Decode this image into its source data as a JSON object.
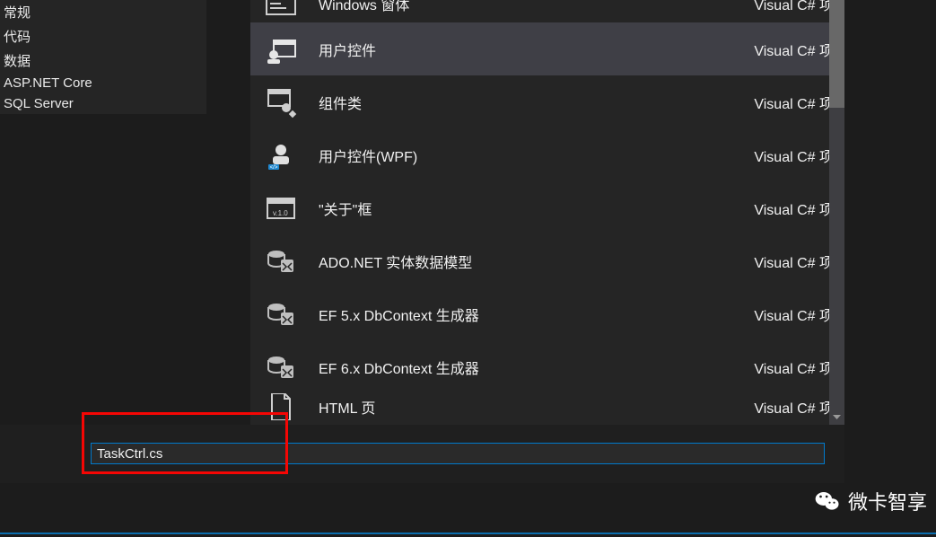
{
  "sidebar": {
    "items": [
      {
        "label": "常规"
      },
      {
        "label": "代码"
      },
      {
        "label": "数据"
      },
      {
        "label": "ASP.NET Core"
      },
      {
        "label": "SQL Server"
      }
    ]
  },
  "templates": {
    "lang": "Visual C# 项",
    "items": [
      {
        "label": "Windows 窗体",
        "icon": "winform",
        "selected": false
      },
      {
        "label": "用户控件",
        "icon": "usercontrol",
        "selected": true
      },
      {
        "label": "组件类",
        "icon": "component",
        "selected": false
      },
      {
        "label": "用户控件(WPF)",
        "icon": "ucwpf",
        "selected": false
      },
      {
        "label": "\"关于\"框",
        "icon": "about",
        "selected": false
      },
      {
        "label": "ADO.NET 实体数据模型",
        "icon": "ef",
        "selected": false
      },
      {
        "label": "EF 5.x DbContext 生成器",
        "icon": "ef",
        "selected": false
      },
      {
        "label": "EF 6.x DbContext 生成器",
        "icon": "ef",
        "selected": false
      },
      {
        "label": "HTML 页",
        "icon": "html",
        "selected": false
      }
    ]
  },
  "name_input": {
    "value": "TaskCtrl.cs"
  },
  "watermark": "微卡智享"
}
